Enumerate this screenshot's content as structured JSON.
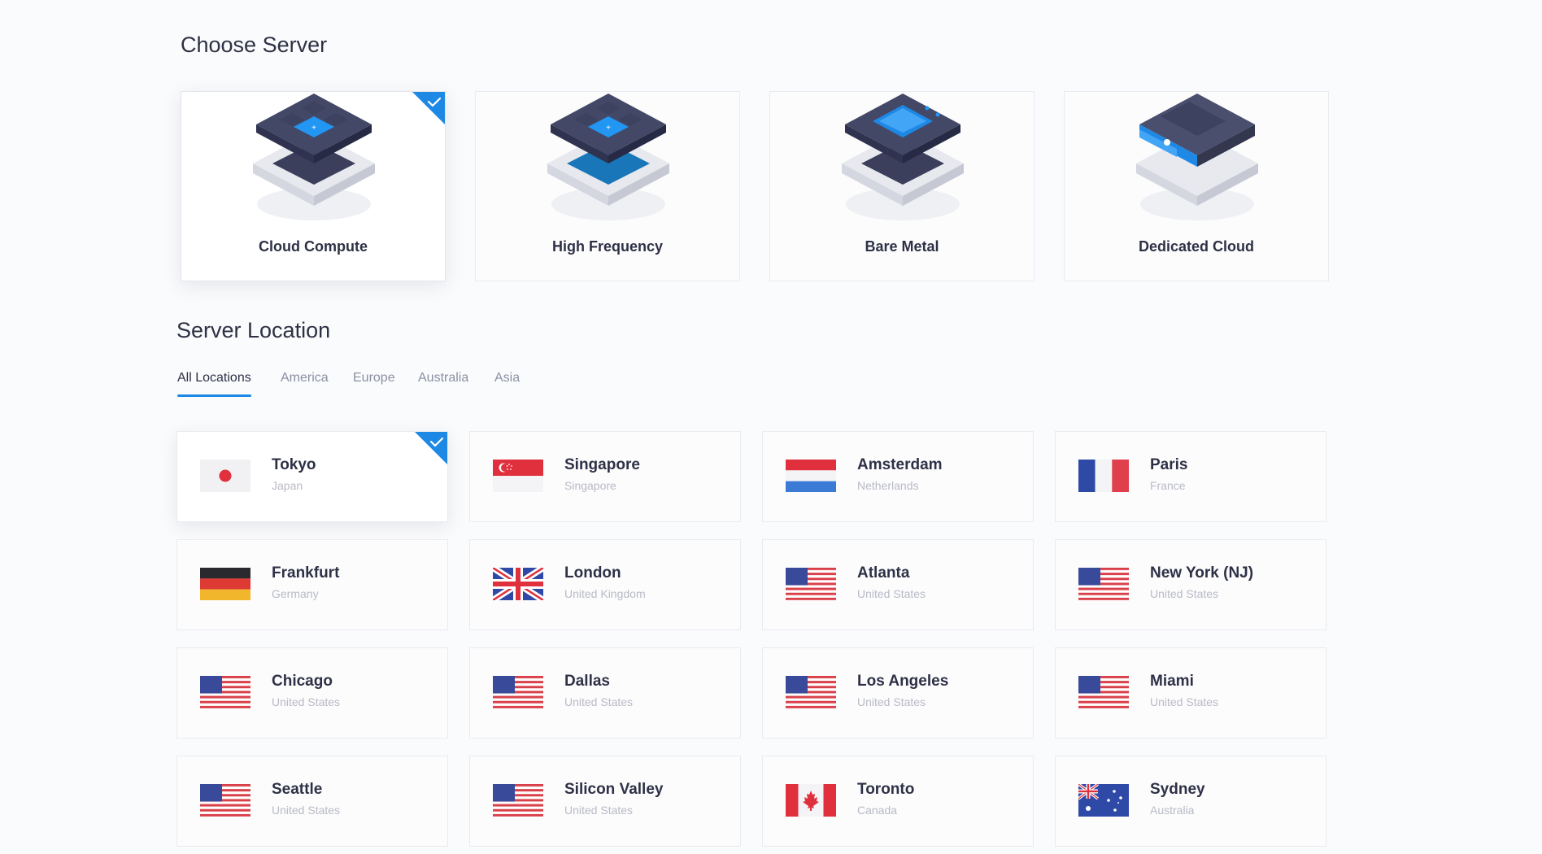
{
  "sections": {
    "choose_server": "Choose Server",
    "server_location": "Server Location"
  },
  "servers": [
    {
      "label": "Cloud Compute",
      "selected": true
    },
    {
      "label": "High Frequency",
      "selected": false
    },
    {
      "label": "Bare Metal",
      "selected": false
    },
    {
      "label": "Dedicated Cloud",
      "selected": false
    }
  ],
  "tabs": [
    {
      "label": "All Locations",
      "active": true
    },
    {
      "label": "America",
      "active": false
    },
    {
      "label": "Europe",
      "active": false
    },
    {
      "label": "Australia",
      "active": false
    },
    {
      "label": "Asia",
      "active": false
    }
  ],
  "locations": [
    {
      "city": "Tokyo",
      "country": "Japan",
      "flag": "japan-flag-icon",
      "selected": true
    },
    {
      "city": "Singapore",
      "country": "Singapore",
      "flag": "singapore-flag-icon"
    },
    {
      "city": "Amsterdam",
      "country": "Netherlands",
      "flag": "netherlands-flag-icon"
    },
    {
      "city": "Paris",
      "country": "France",
      "flag": "france-flag-icon"
    },
    {
      "city": "Frankfurt",
      "country": "Germany",
      "flag": "germany-flag-icon"
    },
    {
      "city": "London",
      "country": "United Kingdom",
      "flag": "uk-flag-icon"
    },
    {
      "city": "Atlanta",
      "country": "United States",
      "flag": "us-flag-icon"
    },
    {
      "city": "New York (NJ)",
      "country": "United States",
      "flag": "us-flag-icon"
    },
    {
      "city": "Chicago",
      "country": "United States",
      "flag": "us-flag-icon"
    },
    {
      "city": "Dallas",
      "country": "United States",
      "flag": "us-flag-icon"
    },
    {
      "city": "Los Angeles",
      "country": "United States",
      "flag": "us-flag-icon"
    },
    {
      "city": "Miami",
      "country": "United States",
      "flag": "us-flag-icon"
    },
    {
      "city": "Seattle",
      "country": "United States",
      "flag": "us-flag-icon"
    },
    {
      "city": "Silicon Valley",
      "country": "United States",
      "flag": "us-flag-icon"
    },
    {
      "city": "Toronto",
      "country": "Canada",
      "flag": "canada-flag-icon"
    },
    {
      "city": "Sydney",
      "country": "Australia",
      "flag": "australia-flag-icon"
    }
  ],
  "colors": {
    "accent": "#1e88e5",
    "text_dark": "#2e3146",
    "text_muted": "#b8bac6"
  }
}
